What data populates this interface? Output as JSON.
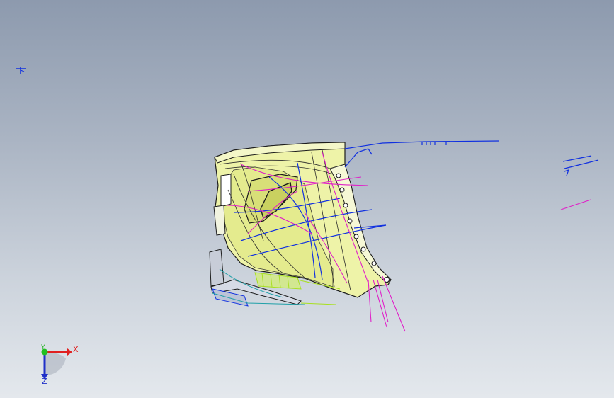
{
  "viewport": {
    "background_top": "#8d9aae",
    "background_bottom": "#e4e8ed"
  },
  "colors": {
    "surface_fill": "#eef3a8",
    "surface_shadow": "#d8e07a",
    "edge": "#1c1c1c",
    "curve_blue": "#1030e0",
    "curve_magenta": "#e020c8",
    "mesh_green": "#a8e020",
    "mesh_teal": "#20a0a8"
  },
  "triad": {
    "x_label": "X",
    "y_label": "Y",
    "z_label": "Z",
    "x_color": "#e02020",
    "y_color": "#20b020",
    "z_color": "#2030c8"
  }
}
